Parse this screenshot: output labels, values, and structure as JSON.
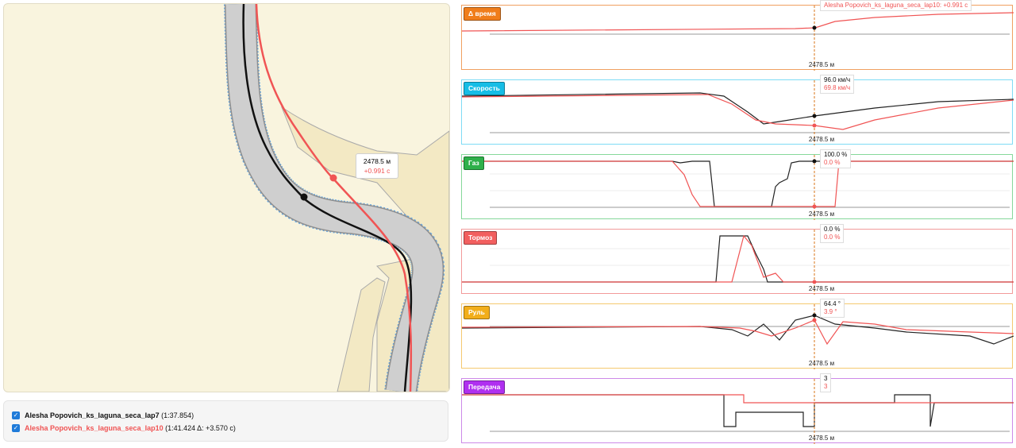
{
  "map": {
    "tooltip_distance": "2478.5 м",
    "tooltip_delta": "+0.991 с"
  },
  "legend": {
    "lap1_name": "Alesha Popovich_ks_laguna_seca_lap7",
    "lap1_time": "(1:37.854)",
    "lap2_name": "Alesha Popovich_ks_laguna_seca_lap10",
    "lap2_time": "(1:41.424 Δ: +3.570 с)"
  },
  "colors": {
    "lap1": "#111111",
    "lap2": "#f05454",
    "delta_badge": "#f07d1b",
    "speed_badge": "#16bde6",
    "throttle_badge": "#2fb04a",
    "brake_badge": "#f25f5f",
    "steer_badge": "#f2ae1a",
    "gear_badge": "#b02ff0"
  },
  "panels": [
    {
      "id": "delta",
      "label": "Δ время",
      "x_label": "2478.5 м",
      "tip_top": "Alesha Popovich_ks_laguna_seca_lap10: +0.991 с",
      "tip_bottom": ""
    },
    {
      "id": "speed",
      "label": "Скорость",
      "x_label": "2478.5 м",
      "tip_top": "96.0 км/ч",
      "tip_bottom": "69.8 км/ч"
    },
    {
      "id": "throttle",
      "label": "Газ",
      "x_label": "2478.5 м",
      "tip_top": "100.0 %",
      "tip_bottom": "0.0 %"
    },
    {
      "id": "brake",
      "label": "Тормоз",
      "x_label": "2478.5 м",
      "tip_top": "0.0 %",
      "tip_bottom": "0.0 %"
    },
    {
      "id": "steer",
      "label": "Руль",
      "x_label": "2478.5 м",
      "tip_top": "64.4 °",
      "tip_bottom": "3.9 °"
    },
    {
      "id": "gear",
      "label": "Передача",
      "x_label": "2478.5 м",
      "tip_top": "3",
      "tip_bottom": "3"
    }
  ]
}
